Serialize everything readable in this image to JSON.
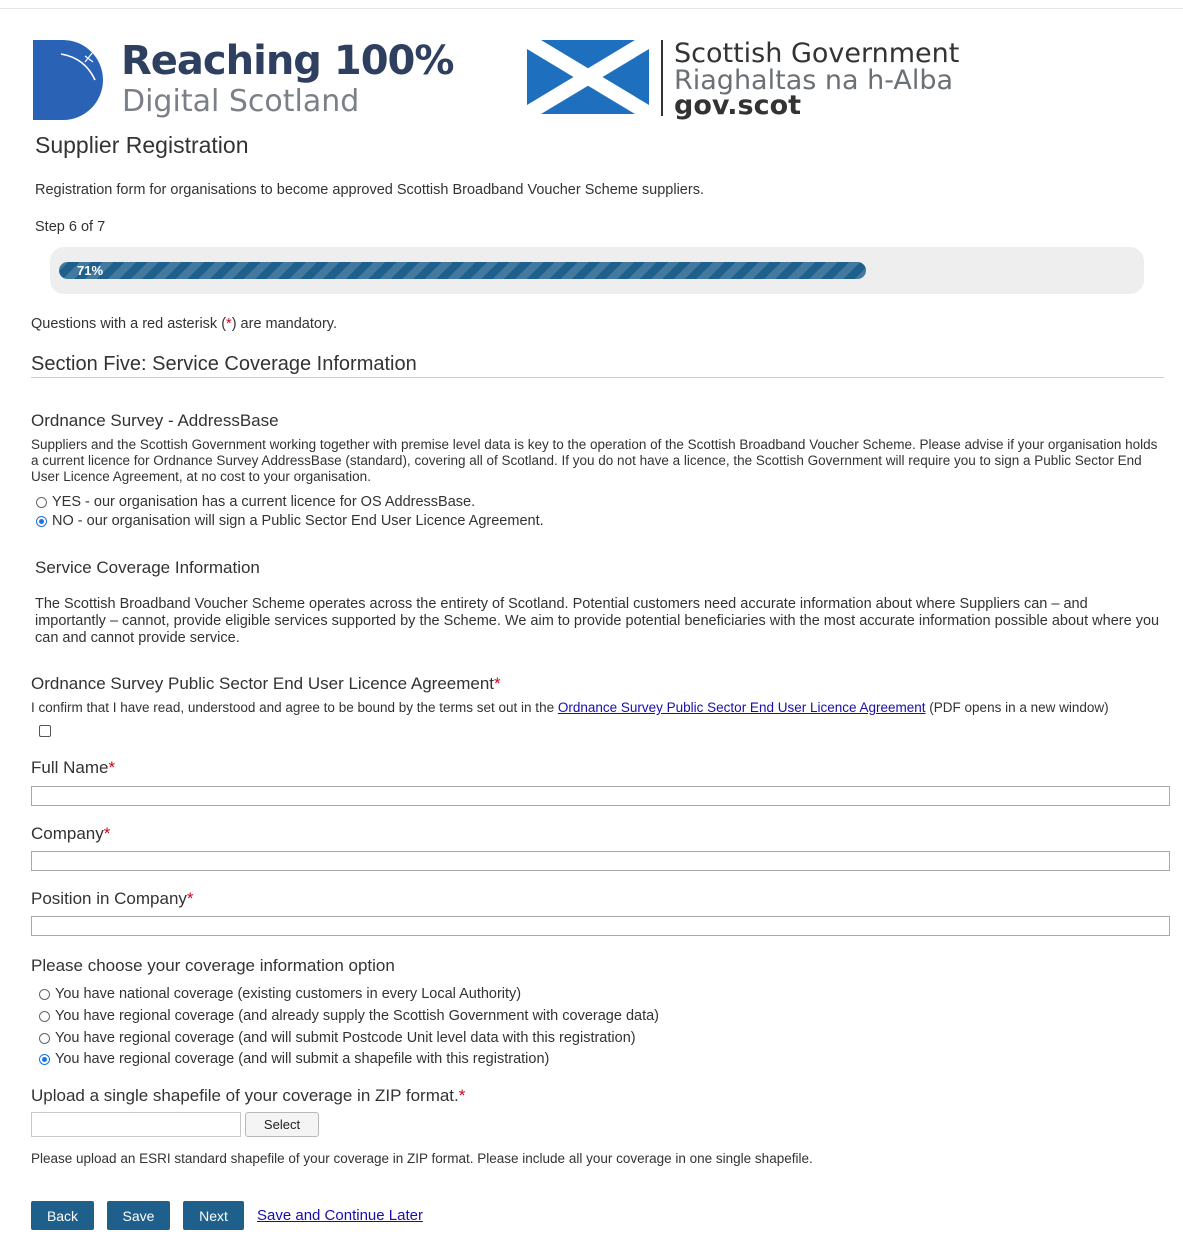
{
  "logos": {
    "r100_title": "Reaching 100%",
    "r100_subtitle": "Digital Scotland",
    "sg_line1": "Scottish Government",
    "sg_line2": "Riaghaltas na h-Alba",
    "sg_line3": "gov.scot"
  },
  "page": {
    "title": "Supplier Registration",
    "intro": "Registration form for organisations to become approved Scottish Broadband Voucher Scheme suppliers.",
    "step": "Step 6 of 7",
    "progress_label": "71%",
    "progress_value": 0.71,
    "mandatory_before": "Questions with a red asterisk (",
    "mandatory_star": "*",
    "mandatory_after": ") are mandatory."
  },
  "section": {
    "title": "Section Five: Service Coverage Information"
  },
  "addressbase": {
    "heading": "Ordnance Survey - AddressBase",
    "description": "Suppliers and the Scottish Government working together with premise level data is key to the operation of the Scottish Broadband Voucher Scheme. Please advise if your organisation holds a current licence for Ordnance Survey AddressBase (standard), covering all of Scotland. If you do not have a licence, the Scottish Government will require you to sign a Public Sector End User Licence Agreement, at no cost to your organisation.",
    "options": [
      {
        "label": "YES - our organisation has a current licence for OS AddressBase.",
        "selected": false
      },
      {
        "label": "NO - our organisation will sign a Public Sector End User Licence Agreement.",
        "selected": true
      }
    ]
  },
  "coverage_info": {
    "heading": "Service Coverage Information",
    "description": "The Scottish Broadband Voucher Scheme operates across the entirety of Scotland. Potential customers need accurate information about where Suppliers can – and importantly – cannot, provide eligible services supported by the Scheme. We aim to provide potential beneficiaries with the most accurate information possible about where you can and cannot provide service."
  },
  "licence": {
    "heading": "Ordnance Survey Public Sector End User Licence Agreement",
    "star": "*",
    "confirm_before": "I confirm that I have read, understood and agree to be bound by the terms set out in the ",
    "link_text": "Ordnance Survey Public Sector End User Licence Agreement",
    "confirm_after": " (PDF opens in a new window)",
    "checked": false
  },
  "fields": {
    "full_name_label": "Full Name",
    "company_label": "Company",
    "position_label": "Position in Company",
    "star": "*",
    "full_name_value": "",
    "company_value": "",
    "position_value": ""
  },
  "coverage_option": {
    "heading": "Please choose your coverage information option",
    "options": [
      {
        "label": "You have national coverage (existing customers in every Local Authority)",
        "selected": false
      },
      {
        "label": "You have regional coverage (and already supply the Scottish Government with coverage data)",
        "selected": false
      },
      {
        "label": "You have regional coverage (and will submit Postcode Unit level data with this registration)",
        "selected": false
      },
      {
        "label": "You have regional coverage (and will submit a shapefile with this registration)",
        "selected": true
      }
    ]
  },
  "upload": {
    "heading": "Upload a single shapefile of your coverage in ZIP format.",
    "star": "*",
    "select_label": "Select",
    "help": "Please upload an ESRI standard shapefile of your coverage in ZIP format. Please include all your coverage in one single shapefile."
  },
  "actions": {
    "back": "Back",
    "save": "Save",
    "next": "Next",
    "save_later": "Save and Continue Later"
  },
  "colors": {
    "primary_button": "#1f5f8c",
    "required_star": "#d0021b",
    "link": "#1a0dab",
    "radio_selected": "#1a73e8"
  },
  "icons": {
    "r100": "reaching-100-logo-mark",
    "sg": "saltire-flag"
  }
}
